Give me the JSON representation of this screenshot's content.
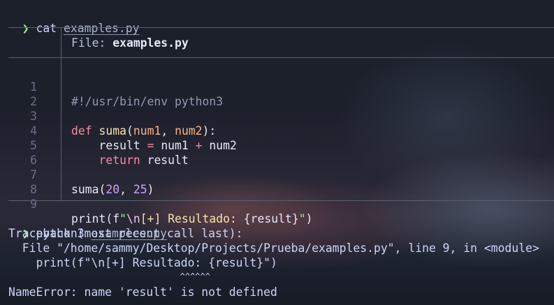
{
  "prompt": {
    "symbol": "❯",
    "first_command": {
      "cmd": "cat",
      "arg": "examples.py"
    },
    "second_command": {
      "cmd": "python3",
      "arg": "examples.py"
    }
  },
  "bat": {
    "file_label": "File: ",
    "file_name": "examples.py",
    "line_numbers": [
      "1",
      "2",
      "3",
      "4",
      "5",
      "6",
      "7",
      "8",
      "9"
    ]
  },
  "code": {
    "l1": "#!/usr/bin/env python3",
    "l3": {
      "def": "def",
      "fn": "suma",
      "open": "(",
      "p1": "num1",
      "comma": ", ",
      "p2": "num2",
      "close": "):"
    },
    "l4": {
      "indent": "    ",
      "result": "result",
      "eq": " = ",
      "a": "num1",
      "plus": " + ",
      "b": "num2"
    },
    "l5": {
      "indent": "    ",
      "ret": "return",
      "val": " result"
    },
    "l7": {
      "fn": "suma",
      "open": "(",
      "n1": "20",
      "comma": ", ",
      "n2": "25",
      "close": ")"
    },
    "l9": {
      "fn": "print",
      "open": "(",
      "f": "f",
      "q1": "\"",
      "esc": "\\n",
      "text": "[+] Resultado: ",
      "interp": "{result}",
      "q2": "\"",
      "close": ")"
    }
  },
  "traceback": {
    "header": "Traceback (most recent call last):",
    "file_line": "  File \"/home/sammy/Desktop/Projects/Prueba/examples.py\", line 9, in <module>",
    "source_line": "    print(f\"\\n[+] Resultado: {result}\")",
    "caret_line": "                                  ^^^^^^",
    "error": "NameError: name 'result' is not defined"
  }
}
